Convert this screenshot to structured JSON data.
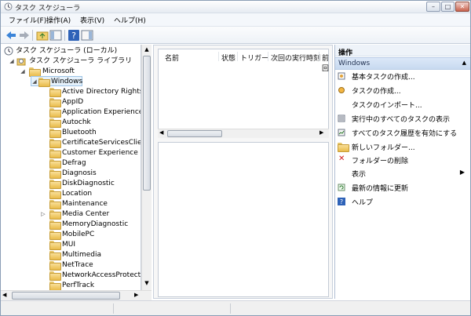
{
  "window": {
    "title": "タスク スケジューラ",
    "min": "–",
    "max": "□",
    "close": "✕"
  },
  "menu": [
    "ファイル(F)",
    "操作(A)",
    "表示(V)",
    "ヘルプ(H)"
  ],
  "tree": {
    "root": "タスク スケジューラ (ローカル)",
    "library": "タスク スケジューラ ライブラリ",
    "microsoft": "Microsoft",
    "windows": "Windows",
    "children": [
      "Active Directory Rights M",
      "AppID",
      "Application Experience",
      "Autochk",
      "Bluetooth",
      "CertificateServicesClient",
      "Customer Experience Im",
      "Defrag",
      "Diagnosis",
      "DiskDiagnostic",
      "Location",
      "Maintenance",
      "Media Center",
      "MemoryDiagnostic",
      "MobilePC",
      "MUI",
      "Multimedia",
      "NetTrace",
      "NetworkAccessProtectio",
      "PerfTrack"
    ]
  },
  "columns": [
    "名前",
    "状態",
    "トリガー",
    "次回の実行時刻",
    "前回"
  ],
  "actions": {
    "header": "操作",
    "section": "Windows",
    "items": [
      "基本タスクの作成...",
      "タスクの作成...",
      "タスクのインポート...",
      "実行中のすべてのタスクの表示",
      "すべてのタスク履歴を有効にする",
      "新しいフォルダー...",
      "フォルダーの削除",
      "表示",
      "最新の情報に更新",
      "ヘルプ"
    ]
  },
  "colors": {
    "accent": "#9ec4e6",
    "folder": "#e9bc4b",
    "delete": "#d11f1f"
  }
}
